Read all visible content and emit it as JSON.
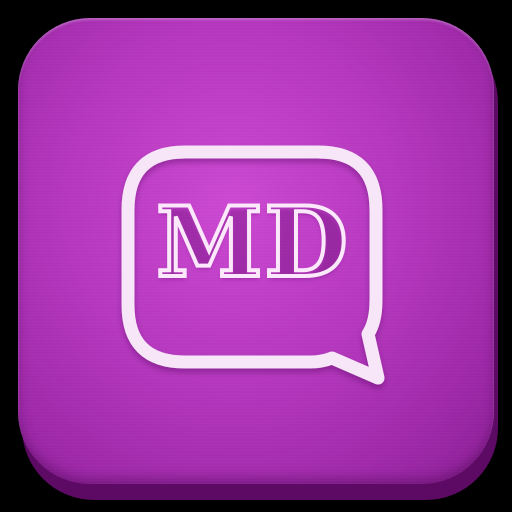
{
  "icon": {
    "monogram": "MD",
    "name": "md-chat-app-icon"
  },
  "colors": {
    "background": "#000000",
    "tile": "#b437bd",
    "tile_edge": "#5c0a63",
    "bubble_stroke": "#f7e6f8"
  },
  "icons": {
    "bubble": "speech-bubble-icon"
  }
}
